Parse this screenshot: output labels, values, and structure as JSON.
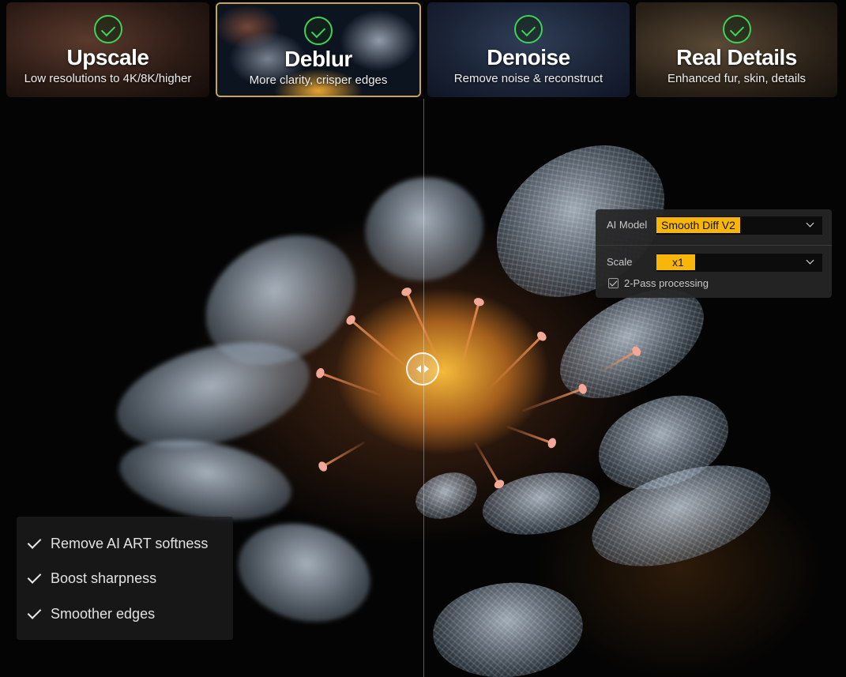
{
  "cards": [
    {
      "title": "Upscale",
      "subtitle": "Low resolutions to 4K/8K/higher"
    },
    {
      "title": "Deblur",
      "subtitle": "More clarity, crisper edges"
    },
    {
      "title": "Denoise",
      "subtitle": "Remove noise & reconstruct"
    },
    {
      "title": "Real Details",
      "subtitle": "Enhanced fur, skin, details"
    }
  ],
  "selected_card": "Deblur",
  "settings": {
    "ai_model_label": "AI Model",
    "ai_model_value": "Smooth Diff V2",
    "scale_label": "Scale",
    "scale_value": "x1",
    "two_pass_label": "2-Pass processing",
    "two_pass_checked": true
  },
  "features": [
    "Remove AI ART softness",
    "Boost sharpness",
    "Smoother edges"
  ],
  "colors": {
    "accent_yellow": "#f8b708",
    "check_green": "#3fd15a",
    "selected_border": "#c9a44a"
  }
}
